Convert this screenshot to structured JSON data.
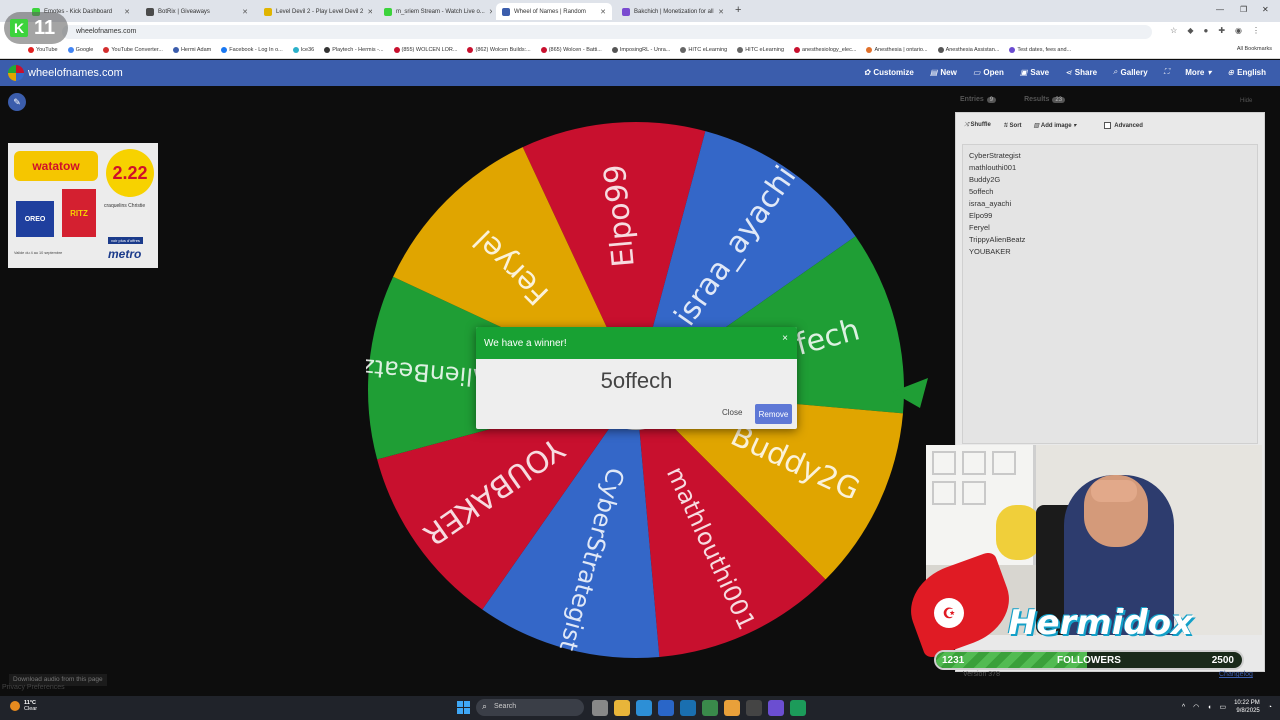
{
  "browser": {
    "tabs": [
      {
        "label": "Emotes - Kick Dashboard",
        "color": "#3cd33c"
      },
      {
        "label": "BotRix | Giveaways",
        "color": "#4b4b4b"
      },
      {
        "label": "Level Devil 2 - Play Level Devil 2",
        "color": "#e0b400"
      },
      {
        "label": "m_sriem Stream - Watch Live o...",
        "color": "#3cd33c"
      },
      {
        "label": "Wheel of Names | Random",
        "color": "#3b5dac"
      },
      {
        "label": "Bakchich | Monetization for all",
        "color": "#7a4bd0"
      }
    ],
    "new_tab": "+",
    "url": "wheelofnames.com",
    "stream_badge_number": "11",
    "bookmarks": [
      "YouTube",
      "Google",
      "YouTube Converter...",
      "Hermi Adam",
      "Facebook - Log In o...",
      "Ice36",
      "Playtech - Hermis -...",
      "(855) WOLCEN LOR...",
      "(862) Wolcen Builds:...",
      "(865) Wolcen - Batti...",
      "ImposingRL - Unra...",
      "HITC eLearning",
      "HITC eLearning",
      "anesthesiology_elec...",
      "Anesthesia | ontario...",
      "Anesthesia Assistan...",
      "Test dates, fees and..."
    ],
    "all_bookmarks": "All Bookmarks"
  },
  "site": {
    "logo_text": "wheelofnames.com",
    "nav": [
      {
        "label": "Customize",
        "icon": "palette-icon"
      },
      {
        "label": "New",
        "icon": "new-file-icon"
      },
      {
        "label": "Open",
        "icon": "folder-icon"
      },
      {
        "label": "Save",
        "icon": "save-icon"
      },
      {
        "label": "Share",
        "icon": "share-icon"
      },
      {
        "label": "Gallery",
        "icon": "search-icon"
      },
      {
        "label": "",
        "icon": "fullscreen-icon"
      },
      {
        "label": "More",
        "icon": "chevron-down-icon"
      },
      {
        "label": "English",
        "icon": "globe-icon"
      }
    ]
  },
  "ad": {
    "headline": "watatow",
    "price": "2.22",
    "product1": "OREO",
    "product2": "RITZ",
    "desc": "craquelins Christie",
    "offer": "voir plus d'offres",
    "brand": "metro",
    "small_print": "Valide du 4 au 10 septembre"
  },
  "left_footer": {
    "download_audio": "Download audio from this page",
    "privacy": "Privacy Preferences"
  },
  "wheel": {
    "segments": [
      {
        "label": "Elpo99",
        "color": "#c8102e"
      },
      {
        "label": "israa_ayachi",
        "color": "#3467c8"
      },
      {
        "label": "5offech",
        "color": "#1f9e35"
      },
      {
        "label": "Buddy2G",
        "color": "#e0a500"
      },
      {
        "label": "mathlouthi001",
        "color": "#c8102e"
      },
      {
        "label": "CyberStrategist",
        "color": "#3467c8"
      },
      {
        "label": "YOUBAKER",
        "color": "#c8102e"
      },
      {
        "label": "TrippyAlienBeatz",
        "color": "#1f9e35"
      },
      {
        "label": "Feryel",
        "color": "#e0a500"
      }
    ]
  },
  "dialog": {
    "title": "We have a winner!",
    "close_x": "×",
    "winner": "5offech",
    "close_label": "Close",
    "remove_label": "Remove"
  },
  "right_panel": {
    "tabs": [
      {
        "label": "Entries",
        "count": "9"
      },
      {
        "label": "Results",
        "count": "23"
      }
    ],
    "hide": "Hide",
    "toolbar": {
      "shuffle": "Shuffle",
      "sort": "Sort",
      "add_image": "Add image",
      "advanced": "Advanced"
    },
    "entries": [
      "CyberStrategist",
      "mathlouthi001",
      "Buddy2G",
      "5offech",
      "israa_ayachi",
      "Elpo99",
      "Feryel",
      "TrippyAlienBeatz",
      "YOUBAKER"
    ],
    "version": "Version 378",
    "changelog": "Changelog"
  },
  "overlay": {
    "streamer_name": "Hermidox",
    "followers": {
      "current": "1231",
      "label": "FOLLOWERS",
      "goal": "2500",
      "progress": 0.4924
    }
  },
  "taskbar": {
    "weather_temp": "11°C",
    "weather_cond": "Clear",
    "search_placeholder": "Search",
    "time": "10:22 PM",
    "date": "9/8/2025"
  }
}
